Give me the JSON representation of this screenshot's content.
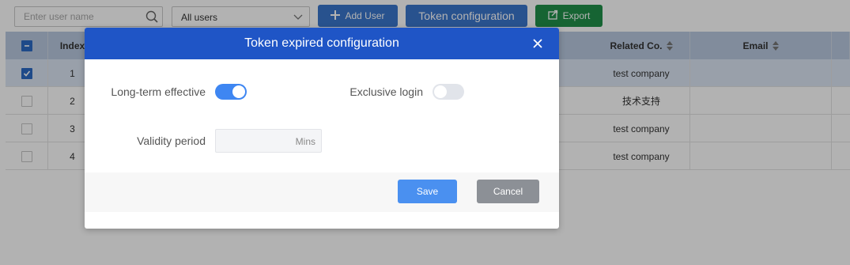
{
  "toolbar": {
    "search_placeholder": "Enter user name",
    "user_filter": "All users",
    "add_user": "Add User",
    "token_config": "Token configuration",
    "export": "Export"
  },
  "table": {
    "headers": {
      "index": "Index",
      "related_co": "Related Co.",
      "email": "Email"
    },
    "rows": [
      {
        "index": "1",
        "company": "test company",
        "checked": true
      },
      {
        "index": "2",
        "company": "技术支持",
        "checked": false
      },
      {
        "index": "3",
        "company": "test company",
        "checked": false
      },
      {
        "index": "4",
        "company": "test company",
        "checked": false
      }
    ]
  },
  "modal": {
    "title": "Token expired configuration",
    "long_term_label": "Long-term effective",
    "long_term_on": true,
    "exclusive_label": "Exclusive login",
    "exclusive_on": false,
    "validity_label": "Validity period",
    "validity_value": "",
    "validity_unit": "Mins",
    "save": "Save",
    "cancel": "Cancel"
  },
  "colors": {
    "primary": "#3a76cc",
    "modal_header": "#1f55c6",
    "export": "#20904a",
    "toggle_on": "#3e86f2"
  }
}
